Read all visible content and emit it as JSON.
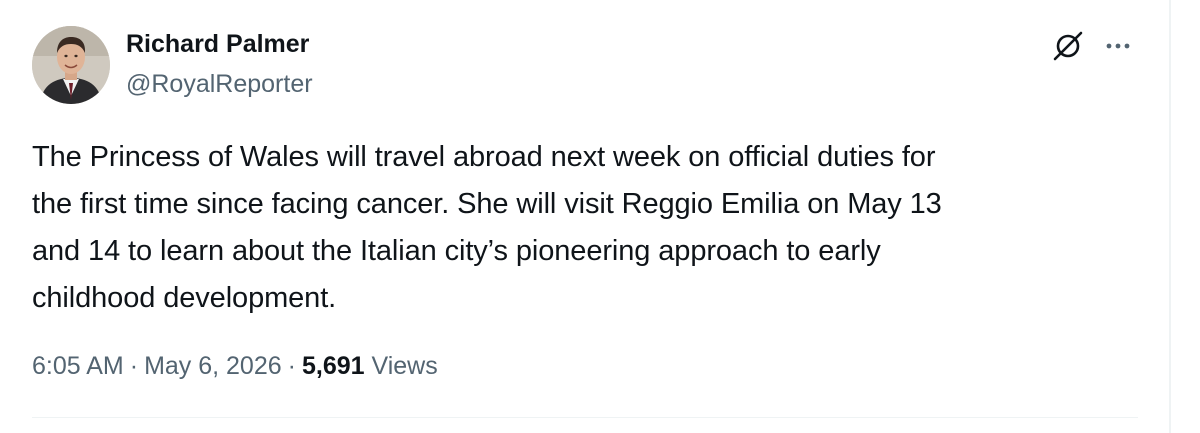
{
  "author": {
    "display_name": "Richard Palmer",
    "handle": "@RoyalReporter"
  },
  "header_icons": {
    "grok": "slashed-circle-icon",
    "more": "more-horizontal-icon"
  },
  "tweet": {
    "lines": [
      "The Princess of Wales will travel abroad next week on official duties for",
      "the first time since facing cancer. She will visit Reggio Emilia on May 13",
      "and 14 to learn about the Italian city’s pioneering approach to early",
      "childhood development."
    ]
  },
  "meta": {
    "time": "6:05 AM",
    "separator": "·",
    "date": "May 6, 2026",
    "views_count": "5,691",
    "views_label": "Views"
  },
  "colors": {
    "text_primary": "#0f1419",
    "text_secondary": "#536471",
    "divider": "#eff3f4"
  }
}
